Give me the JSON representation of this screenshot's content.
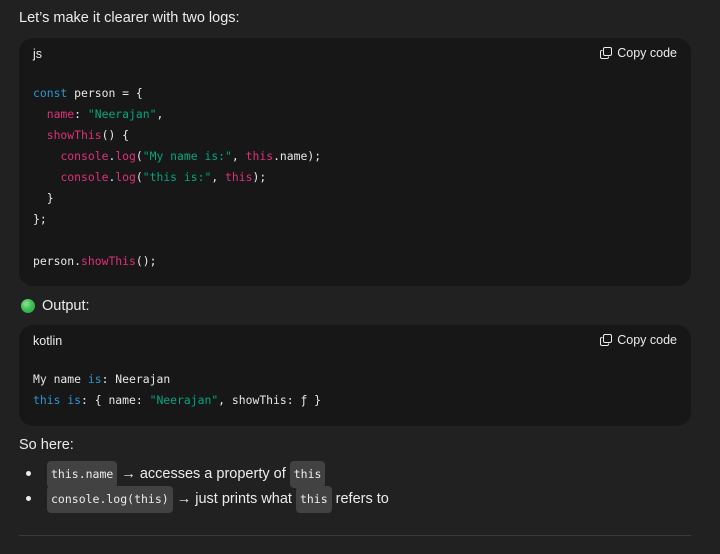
{
  "intro": "Let’s make it clearer with two logs:",
  "code_block_1": {
    "language": "js",
    "copy_label": "Copy code",
    "lines": [
      [
        {
          "t": "const",
          "c": "kw"
        },
        {
          "t": " person = {",
          "c": "pl"
        }
      ],
      [
        {
          "t": "  ",
          "c": "pl"
        },
        {
          "t": "name",
          "c": "pr"
        },
        {
          "t": ": ",
          "c": "pl"
        },
        {
          "t": "\"Neerajan\"",
          "c": "st"
        },
        {
          "t": ",",
          "c": "pl"
        }
      ],
      [
        {
          "t": "  ",
          "c": "pl"
        },
        {
          "t": "showThis",
          "c": "pr"
        },
        {
          "t": "() {",
          "c": "pl"
        }
      ],
      [
        {
          "t": "    ",
          "c": "pl"
        },
        {
          "t": "console",
          "c": "pr"
        },
        {
          "t": ".",
          "c": "pl"
        },
        {
          "t": "log",
          "c": "pr"
        },
        {
          "t": "(",
          "c": "pl"
        },
        {
          "t": "\"My name is:\"",
          "c": "st"
        },
        {
          "t": ", ",
          "c": "pl"
        },
        {
          "t": "this",
          "c": "pr"
        },
        {
          "t": ".name);",
          "c": "pl"
        }
      ],
      [
        {
          "t": "    ",
          "c": "pl"
        },
        {
          "t": "console",
          "c": "pr"
        },
        {
          "t": ".",
          "c": "pl"
        },
        {
          "t": "log",
          "c": "pr"
        },
        {
          "t": "(",
          "c": "pl"
        },
        {
          "t": "\"this is:\"",
          "c": "st"
        },
        {
          "t": ", ",
          "c": "pl"
        },
        {
          "t": "this",
          "c": "pr"
        },
        {
          "t": ");",
          "c": "pl"
        }
      ],
      [
        {
          "t": "  }",
          "c": "pl"
        }
      ],
      [
        {
          "t": "};",
          "c": "pl"
        }
      ],
      [
        {
          "t": "",
          "c": "pl"
        }
      ],
      [
        {
          "t": "person.",
          "c": "pl"
        },
        {
          "t": "showThis",
          "c": "pr"
        },
        {
          "t": "();",
          "c": "pl"
        }
      ]
    ]
  },
  "output_label": "Output:",
  "code_block_2": {
    "language": "kotlin",
    "copy_label": "Copy code",
    "lines": [
      [
        {
          "t": "My name ",
          "c": "pl"
        },
        {
          "t": "is",
          "c": "kw"
        },
        {
          "t": ": Neerajan",
          "c": "pl"
        }
      ],
      [
        {
          "t": "this",
          "c": "kw"
        },
        {
          "t": " ",
          "c": "pl"
        },
        {
          "t": "is",
          "c": "kw"
        },
        {
          "t": ": { name: ",
          "c": "pl"
        },
        {
          "t": "\"Neerajan\"",
          "c": "st"
        },
        {
          "t": ", showThis: ƒ }",
          "c": "pl"
        }
      ]
    ]
  },
  "so_here": "So here:",
  "bullets": [
    {
      "code": "this.name",
      "text": "→ accesses a property of",
      "code2": "this",
      "text2": ""
    },
    {
      "code": "console.log(this)",
      "text": "→ just prints what",
      "code2": "this",
      "text2": "refers to"
    }
  ],
  "colors": {
    "keyword": "#2e95d3",
    "property": "#df3079",
    "string": "#00a67d",
    "background": "#212121",
    "code_background": "#171717"
  },
  "icons": {
    "copy": "copy-icon",
    "status": "green-circle-icon"
  }
}
